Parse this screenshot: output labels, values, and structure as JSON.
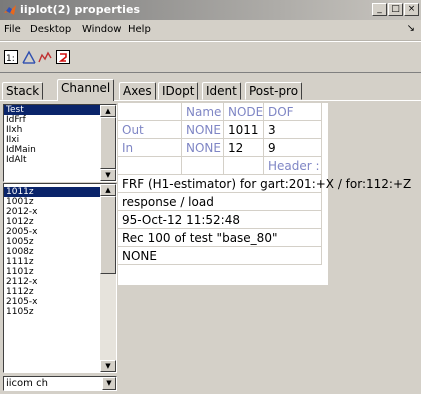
{
  "window": {
    "title": "iiplot(2) properties"
  },
  "menubar": {
    "items": [
      "File",
      "Desktop",
      "Window",
      "Help"
    ],
    "arrow": "↘"
  },
  "toolbar": {
    "icons": [
      "data-cursor-icon",
      "triangle-plot-icon",
      "line-plot-icon",
      "red-refresh-icon"
    ]
  },
  "tabs": [
    "Stack",
    "Channel",
    "Axes",
    "IDopt",
    "Ident",
    "Post-pro"
  ],
  "active_tab": "Channel",
  "list_top": {
    "items": [
      "Test",
      "IdFrf",
      "IIxh",
      "IIxi",
      "IdMain",
      "IdAlt"
    ],
    "selected": "Test"
  },
  "list_channels": {
    "items": [
      "1011z",
      "1001z",
      "2012-x",
      "1012z",
      "2005-x",
      "1005z",
      "1008z",
      "1111z",
      "1101z",
      "2112-x",
      "1112z",
      "2105-x",
      "1105z"
    ],
    "selected": "1011z"
  },
  "popup": {
    "value": "iicom ch"
  },
  "table": {
    "header": [
      "",
      "Name",
      "NODE",
      "DOF"
    ],
    "rows": [
      {
        "label": "Out",
        "name": "NONE",
        "node": "1011",
        "dof": "3"
      },
      {
        "label": "In",
        "name": "NONE",
        "node": "12",
        "dof": "9"
      }
    ],
    "header_col": "Header :",
    "info_lines": [
      "FRF (H1-estimator) for gart:201:+X / for:112:+Z",
      "response / load",
      "95-Oct-12 11:52:48",
      "Rec 100 of test \"base_80\"",
      "NONE"
    ]
  }
}
